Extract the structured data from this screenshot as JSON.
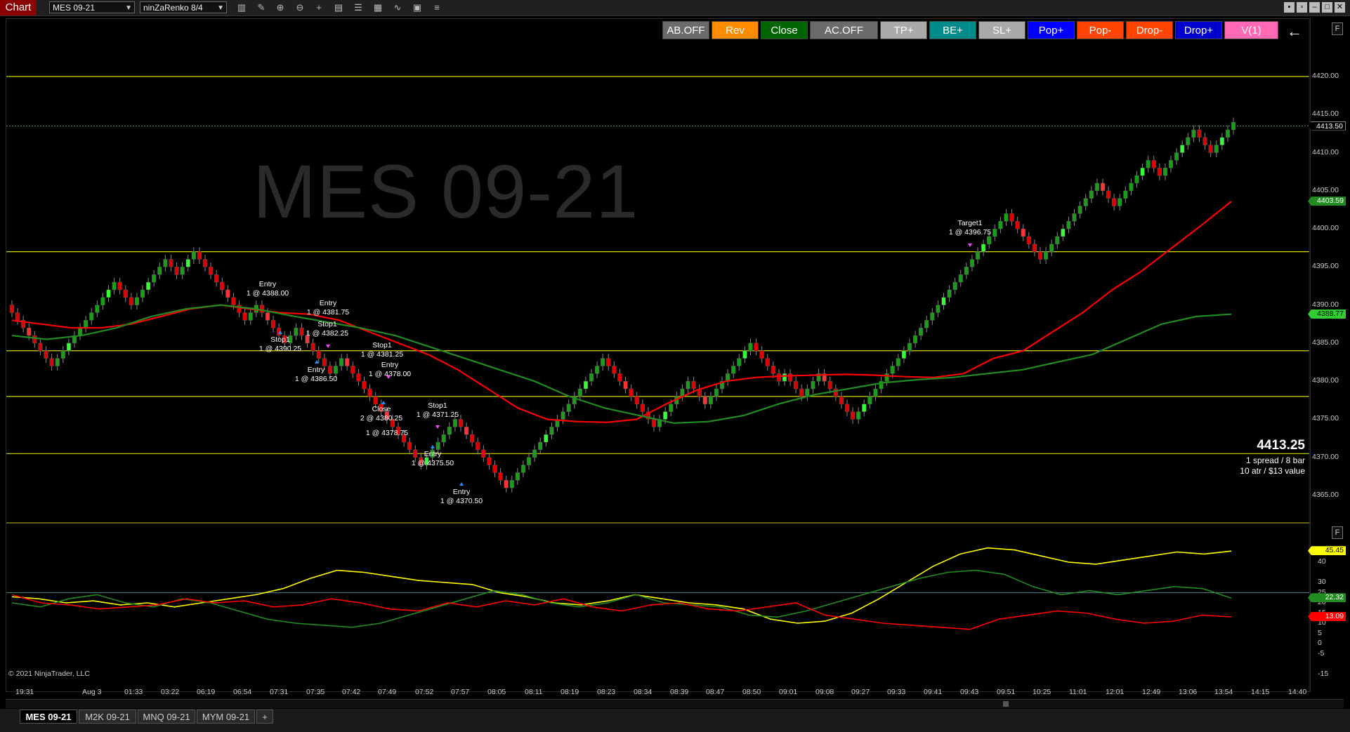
{
  "titlebar": {
    "app_label": "Chart",
    "instrument": "MES 09-21",
    "bar_type": "ninZaRenko 8/4"
  },
  "toolbar_icons": [
    "bars-icon",
    "pencil-icon",
    "zoom-in-icon",
    "zoom-out-icon",
    "crosshair-icon",
    "properties-icon",
    "data-box-icon",
    "indicators-icon",
    "strategies-icon",
    "templates-icon",
    "list-icon"
  ],
  "trade_buttons": [
    {
      "label": "AB.OFF",
      "color": "#6b6b6b"
    },
    {
      "label": "Rev",
      "color": "#ff8c00"
    },
    {
      "label": "Close",
      "color": "#006400"
    },
    {
      "label": "AC.OFF",
      "color": "#6b6b6b"
    },
    {
      "label": "TP+",
      "color": "#a9a9a9"
    },
    {
      "label": "BE+",
      "color": "#008b8b"
    },
    {
      "label": "SL+",
      "color": "#a9a9a9"
    },
    {
      "label": "Pop+",
      "color": "#0000ff"
    },
    {
      "label": "Pop-",
      "color": "#ff4500"
    },
    {
      "label": "Drop-",
      "color": "#ff4500"
    },
    {
      "label": "Drop+",
      "color": "#0000cd"
    },
    {
      "label": "V(1)",
      "color": "#ff69b4"
    }
  ],
  "panel_flag": "F",
  "watermark": "MES 09-21",
  "price_info": {
    "last": "4413.25",
    "line1": "1 spread / 8 bar",
    "line2": "10 atr / $13 value"
  },
  "price_axis": {
    "ticks": [
      "4420.00",
      "4415.00",
      "4410.00",
      "4405.00",
      "4400.00",
      "4395.00",
      "4390.00",
      "4385.00",
      "4380.00",
      "4375.00",
      "4370.00",
      "4365.00"
    ],
    "badges": [
      {
        "label": "4413.50",
        "color": "#000000",
        "text": "#ffffff"
      },
      {
        "label": "4403.59",
        "color": "#228b22",
        "text": "#ffffff"
      },
      {
        "label": "4388.77",
        "color": "#32cd32",
        "text": "#000000"
      }
    ]
  },
  "indicator_axis": {
    "ticks": [
      "40",
      "30",
      "25",
      "20",
      "15",
      "10",
      "5",
      "0",
      "-5",
      "-15"
    ],
    "badges": [
      {
        "label": "45.45",
        "color": "#ffff00",
        "text": "#000000"
      },
      {
        "label": "22.32",
        "color": "#228b22",
        "text": "#ffffff"
      },
      {
        "label": "13.09",
        "color": "#ff0000",
        "text": "#ffffff"
      }
    ]
  },
  "time_axis": [
    "19:31",
    "Aug 3",
    "01:33",
    "03:22",
    "06:19",
    "06:54",
    "07:31",
    "07:35",
    "07:42",
    "07:49",
    "07:52",
    "07:57",
    "08:05",
    "08:11",
    "08:19",
    "08:23",
    "08:34",
    "08:39",
    "08:47",
    "08:50",
    "09:01",
    "09:08",
    "09:27",
    "09:33",
    "09:41",
    "09:43",
    "09:51",
    "10:25",
    "11:01",
    "12:01",
    "12:49",
    "13:06",
    "13:54",
    "14:15",
    "14:40"
  ],
  "copyright": "© 2021 NinjaTrader, LLC",
  "annotations": [
    {
      "l1": "Entry",
      "l2": "1 @ 4388.00"
    },
    {
      "l1": "Entry",
      "l2": "1 @ 4381.75"
    },
    {
      "l1": "Stop1",
      "l2": "1 @ 4382.25"
    },
    {
      "l1": "Stop1",
      "l2": "1 @ 4390.25"
    },
    {
      "l1": "Entry",
      "l2": "1 @ 4386.50"
    },
    {
      "l1": "Stop1",
      "l2": "1 @ 4381.25"
    },
    {
      "l1": "Entry",
      "l2": "1 @ 4378.00"
    },
    {
      "l1": "Close",
      "l2": "2 @ 4380.25"
    },
    {
      "l1": "",
      "l2": "1 @ 4378.75"
    },
    {
      "l1": "Stop1",
      "l2": "1 @ 4371.25"
    },
    {
      "l1": "Entry",
      "l2": "1 @ 4375.50"
    },
    {
      "l1": "Entry",
      "l2": "1 @ 4370.50"
    },
    {
      "l1": "Target1",
      "l2": "1 @ 4396.75"
    }
  ],
  "bottom_tabs": [
    {
      "label": "MES 09-21",
      "active": true
    },
    {
      "label": "M2K 09-21",
      "active": false
    },
    {
      "label": "MNQ 09-21",
      "active": false
    },
    {
      "label": "MYM 09-21",
      "active": false
    },
    {
      "label": "+",
      "active": false
    }
  ],
  "chart_data": [
    {
      "type": "candlestick",
      "title": "MES 09-21",
      "ylim": [
        4362,
        4423
      ],
      "horizontal_levels": [
        4420.0,
        4397.0,
        4384.0,
        4378.0,
        4370.5
      ],
      "current_price_line": 4413.5,
      "bar_closes": [
        4389,
        4388,
        4387,
        4386,
        4385,
        4384,
        4383,
        4382,
        4383,
        4384,
        4385,
        4386,
        4387,
        4388,
        4389,
        4390,
        4391,
        4392,
        4393,
        4392,
        4391,
        4390,
        4391,
        4392,
        4393,
        4394,
        4395,
        4396,
        4395,
        4394,
        4395,
        4396,
        4397,
        4396,
        4395,
        4394,
        4393,
        4392,
        4391,
        4390,
        4389,
        4388,
        4389,
        4390,
        4389,
        4388,
        4387,
        4386,
        4385,
        4386,
        4387,
        4386,
        4385,
        4384,
        4383,
        4382,
        4381,
        4382,
        4383,
        4382,
        4381,
        4380,
        4379,
        4378,
        4377,
        4376,
        4375,
        4374,
        4373,
        4372,
        4371,
        4370,
        4369,
        4370,
        4371,
        4372,
        4373,
        4374,
        4375,
        4374,
        4373,
        4372,
        4371,
        4370,
        4369,
        4368,
        4367,
        4366,
        4367,
        4368,
        4369,
        4370,
        4371,
        4372,
        4373,
        4374,
        4375,
        4376,
        4377,
        4378,
        4379,
        4380,
        4381,
        4382,
        4383,
        4382,
        4381,
        4380,
        4379,
        4378,
        4377,
        4376,
        4375,
        4374,
        4375,
        4376,
        4377,
        4378,
        4379,
        4380,
        4379,
        4378,
        4377,
        4378,
        4379,
        4380,
        4381,
        4382,
        4383,
        4384,
        4385,
        4384,
        4383,
        4382,
        4381,
        4380,
        4381,
        4380,
        4379,
        4378,
        4379,
        4380,
        4381,
        4380,
        4379,
        4378,
        4377,
        4376,
        4375,
        4376,
        4377,
        4378,
        4379,
        4380,
        4381,
        4382,
        4383,
        4384,
        4385,
        4386,
        4387,
        4388,
        4389,
        4390,
        4391,
        4392,
        4393,
        4394,
        4395,
        4396,
        4397,
        4398,
        4399,
        4400,
        4401,
        4402,
        4401,
        4400,
        4399,
        4398,
        4397,
        4396,
        4397,
        4398,
        4399,
        4400,
        4401,
        4402,
        4403,
        4404,
        4405,
        4406,
        4405,
        4404,
        4403,
        4404,
        4405,
        4406,
        4407,
        4408,
        4409,
        4408,
        4407,
        4408,
        4409,
        4410,
        4411,
        4412,
        4413,
        4412,
        4411,
        4410,
        4411,
        4412,
        4413,
        4414
      ],
      "series": [
        {
          "name": "",
          "color": "#ff0000",
          "values": [
            4388,
            4387.5,
            4387,
            4387,
            4387.5,
            4388.5,
            4389.5,
            4390,
            4389.5,
            4389,
            4388.8,
            4388,
            4386.5,
            4385,
            4383.5,
            4381.5,
            4379,
            4376.5,
            4375,
            4374.7,
            4374.6,
            4375,
            4377,
            4378.8,
            4380,
            4380.5,
            4380.7,
            4380.8,
            4380.9,
            4380.8,
            4380.6,
            4380.5,
            4381,
            4383,
            4384,
            4386.5,
            4389,
            4392,
            4394.5,
            4397.5,
            4400.5,
            4403.6
          ]
        },
        {
          "name": "",
          "color": "#228b22",
          "values": [
            4386,
            4385.5,
            4386,
            4387,
            4388.5,
            4389.5,
            4390,
            4389.5,
            4388.6,
            4387.8,
            4387,
            4386,
            4384.5,
            4383,
            4381.5,
            4380,
            4378,
            4376.5,
            4375.5,
            4374.5,
            4374.7,
            4375.5,
            4377,
            4378.2,
            4379,
            4379.8,
            4380.2,
            4380.5,
            4381,
            4381.5,
            4382.5,
            4383.5,
            4385.5,
            4387.5,
            4388.5,
            4388.8
          ]
        }
      ]
    },
    {
      "type": "line",
      "title": "",
      "ylim": [
        -18,
        50
      ],
      "series": [
        {
          "name": "",
          "color": "#ffff00",
          "values": [
            23,
            22,
            20,
            21,
            19,
            20,
            18,
            20,
            22,
            24,
            27,
            32,
            36,
            35,
            33,
            31,
            30,
            29,
            25,
            23,
            20,
            19,
            21,
            24,
            22,
            20,
            19,
            17,
            12,
            10,
            11,
            15,
            22,
            30,
            38,
            44,
            47,
            46,
            43,
            40,
            39,
            41,
            43,
            45,
            44,
            45.45
          ]
        },
        {
          "name": "",
          "color": "#228b22",
          "values": [
            20,
            18,
            22,
            24,
            20,
            18,
            22,
            20,
            16,
            12,
            10,
            9,
            8,
            10,
            14,
            18,
            22,
            26,
            24,
            20,
            18,
            20,
            24,
            20,
            19,
            18,
            14,
            13,
            16,
            20,
            24,
            28,
            32,
            35,
            36,
            34,
            28,
            24,
            26,
            24,
            26,
            28,
            27,
            22.32
          ]
        },
        {
          "name": "",
          "color": "#ff0000",
          "values": [
            24,
            20,
            19,
            17,
            18,
            19,
            22,
            20,
            21,
            18,
            19,
            22,
            20,
            17,
            16,
            20,
            18,
            21,
            19,
            22,
            18,
            16,
            19,
            20,
            17,
            16,
            18,
            20,
            14,
            12,
            10,
            9,
            8,
            7,
            12,
            14,
            16,
            15,
            12,
            10,
            11,
            14,
            13.09
          ]
        }
      ]
    }
  ]
}
